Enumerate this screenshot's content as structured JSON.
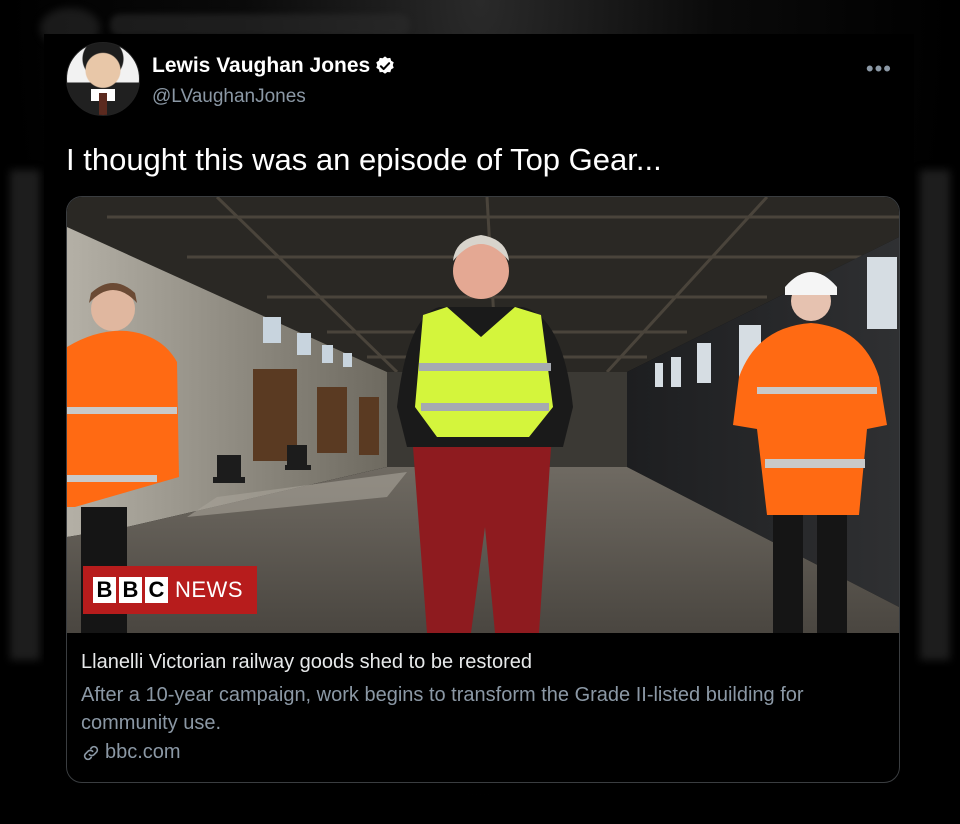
{
  "tweet": {
    "display_name": "Lewis Vaughan Jones",
    "handle": "@LVaughanJones",
    "verified": true,
    "more_label": "•••",
    "text": "I thought this was an episode of Top Gear..."
  },
  "card": {
    "badge": {
      "letters": [
        "B",
        "B",
        "C"
      ],
      "word": "NEWS"
    },
    "title": "Llanelli Victorian railway goods shed to be restored",
    "description": "After a 10-year campaign, work begins to transform the Grade II-listed building for community use.",
    "link": "bbc.com",
    "link_icon": "link-icon"
  },
  "colors": {
    "background": "#000000",
    "text_primary": "#e7e9ea",
    "text_secondary": "#8b98a5",
    "verified_blue": "#ffffff",
    "bbc_red": "#b71c1c",
    "hi_vis_orange": "#ff6a13",
    "hi_vis_yellow": "#d4f53c"
  }
}
